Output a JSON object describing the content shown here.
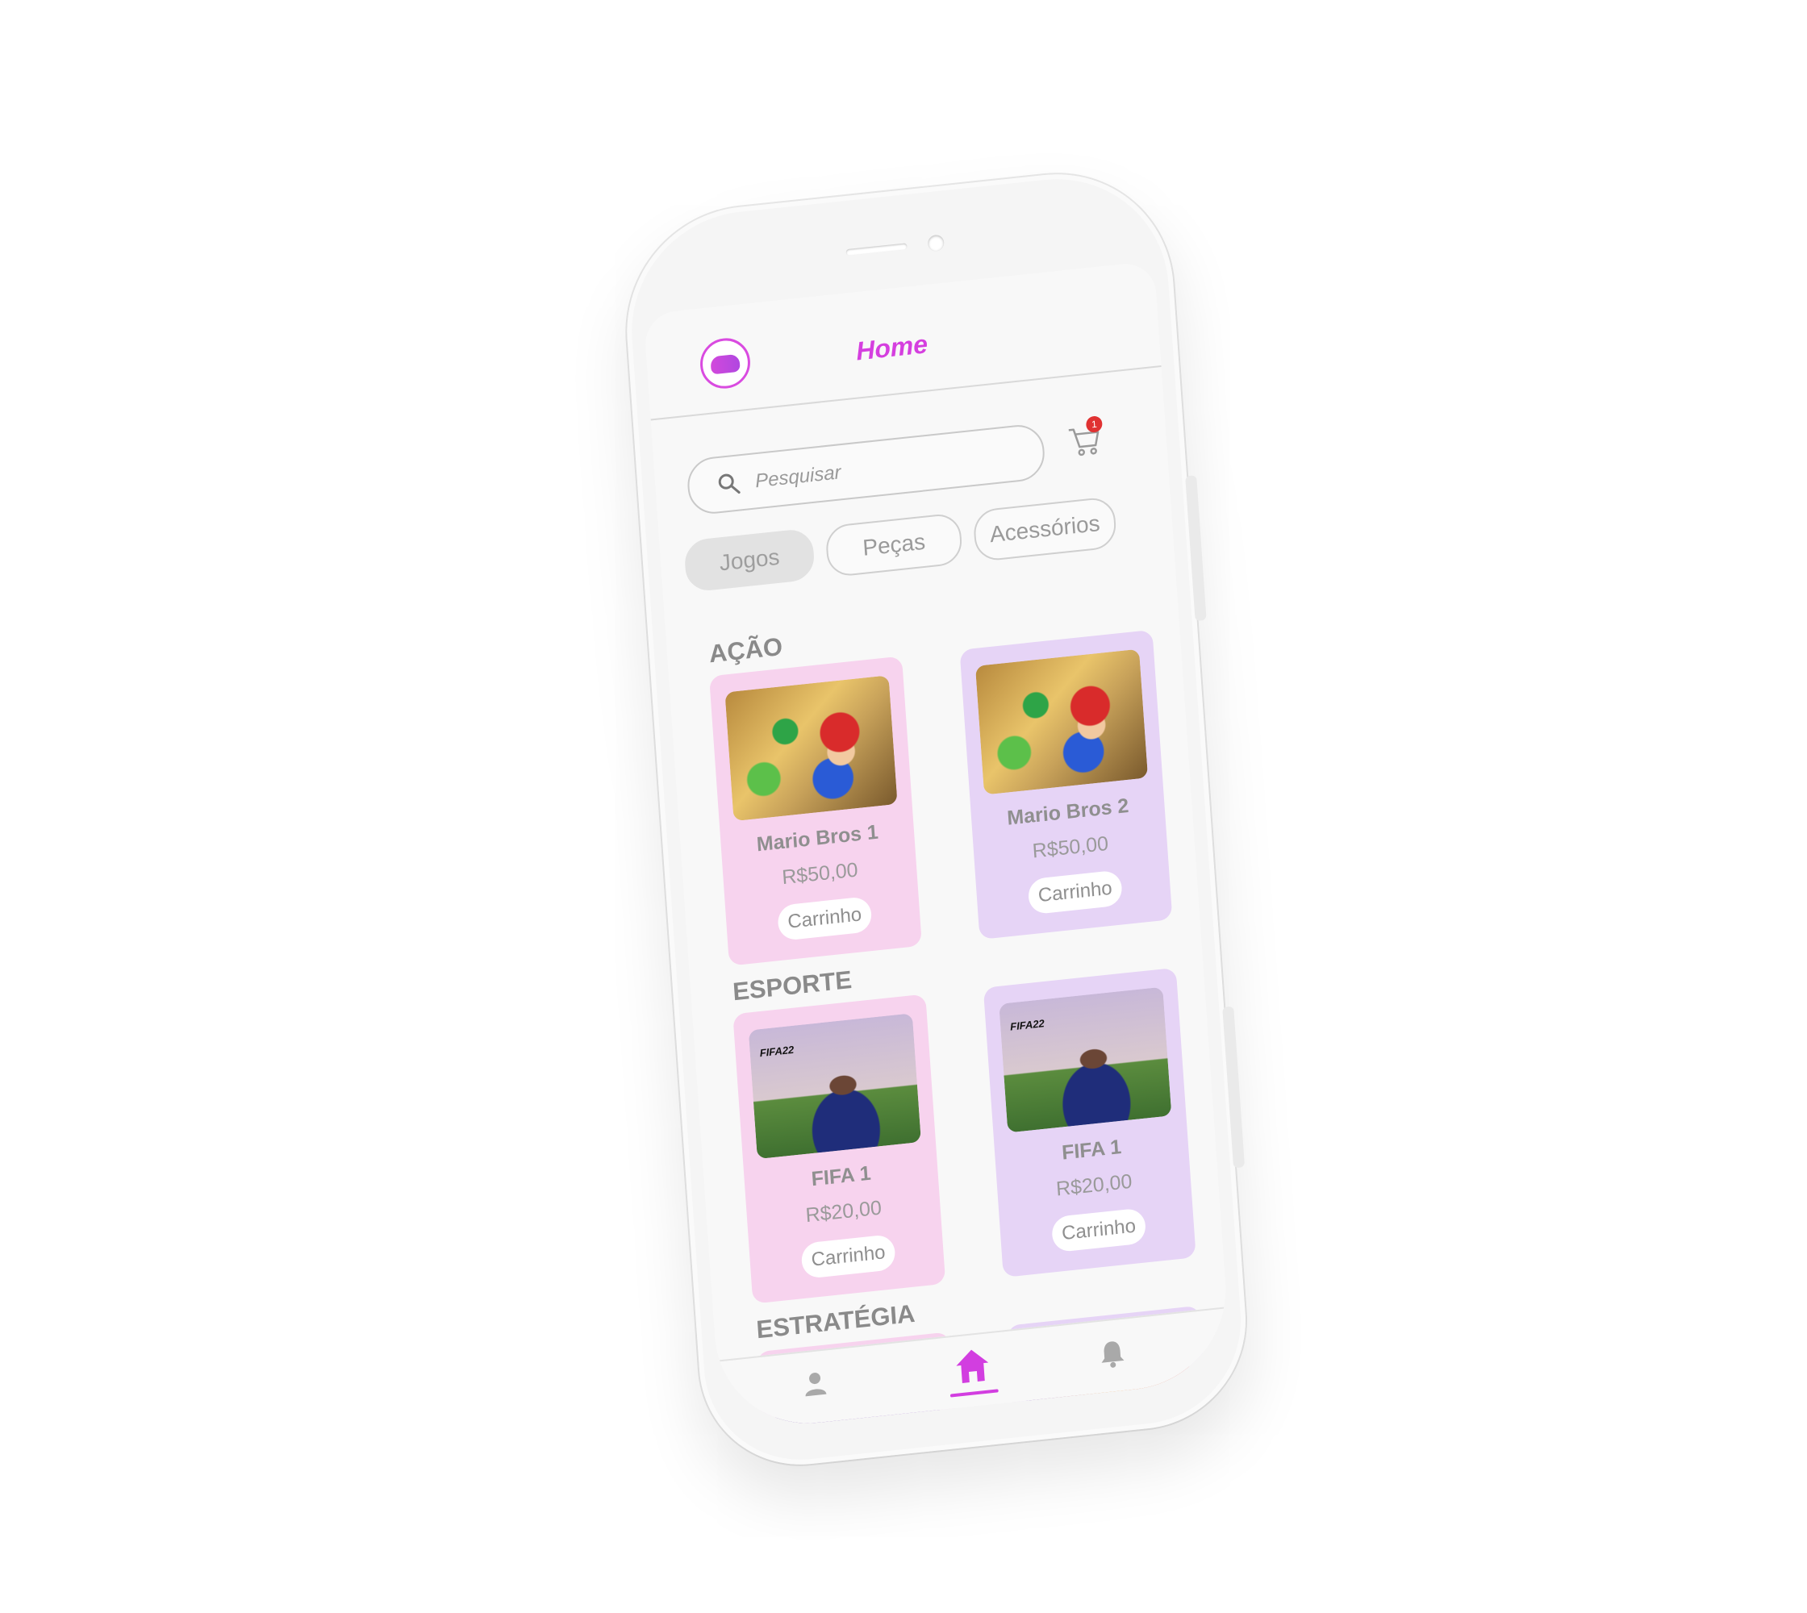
{
  "header": {
    "title": "Home"
  },
  "search": {
    "placeholder": "Pesquisar"
  },
  "cart": {
    "badge": "1"
  },
  "tabs": [
    {
      "label": "Jogos",
      "active": true
    },
    {
      "label": "Peças",
      "active": false
    },
    {
      "label": "Acessórios",
      "active": false
    }
  ],
  "sections": [
    {
      "title": "AÇÃO",
      "items": [
        {
          "name": "Mario Bros 1",
          "price": "R$50,00",
          "button": "Carrinho"
        },
        {
          "name": "Mario Bros 2",
          "price": "R$50,00",
          "button": "Carrinho"
        }
      ]
    },
    {
      "title": "ESPORTE",
      "items": [
        {
          "name": "FIFA 1",
          "price": "R$20,00",
          "button": "Carrinho",
          "logo": "FIFA22"
        },
        {
          "name": "FIFA 1",
          "price": "R$20,00",
          "button": "Carrinho",
          "logo": "FIFA22"
        }
      ]
    },
    {
      "title": "ESTRATÉGIA",
      "items": []
    }
  ],
  "nav": [
    {
      "icon": "user-icon",
      "active": false
    },
    {
      "icon": "home-icon",
      "active": true
    },
    {
      "icon": "bell-icon",
      "active": false
    }
  ],
  "colors": {
    "accent": "#d53fdf",
    "card_pink": "#f7d3ee",
    "card_purple": "#e6d4f6",
    "badge": "#e03232"
  }
}
